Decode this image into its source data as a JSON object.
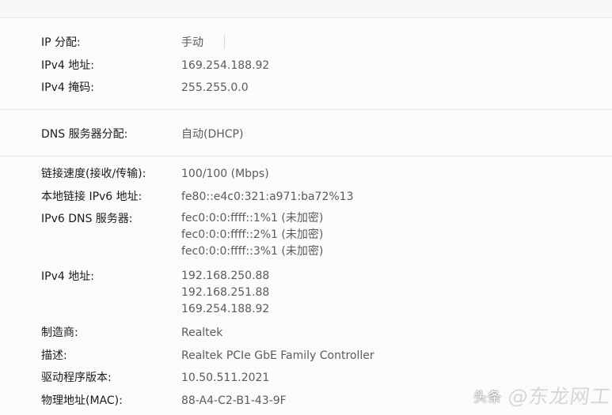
{
  "network_details": {
    "ip_assignment": {
      "label": "IP 分配:",
      "value": "手动"
    },
    "ipv4_address_manual": {
      "label": "IPv4 地址:",
      "value": "169.254.188.92"
    },
    "ipv4_mask": {
      "label": "IPv4 掩码:",
      "value": "255.255.0.0"
    },
    "dns_assignment": {
      "label": "DNS 服务器分配:",
      "value": "自动(DHCP)"
    },
    "link_speed": {
      "label": "链接速度(接收/传输):",
      "value": "100/100 (Mbps)"
    },
    "link_local_ipv6": {
      "label": "本地链接 IPv6 地址:",
      "value": "fe80::e4c0:321:a971:ba72%13"
    },
    "ipv6_dns_servers": {
      "label": "IPv6 DNS 服务器:",
      "values": [
        "fec0:0:0:ffff::1%1 (未加密)",
        "fec0:0:0:ffff::2%1 (未加密)",
        "fec0:0:0:ffff::3%1 (未加密)"
      ]
    },
    "ipv4_addresses": {
      "label": "IPv4 地址:",
      "values": [
        "192.168.250.88",
        "192.168.251.88",
        "169.254.188.92"
      ]
    },
    "manufacturer": {
      "label": "制造商:",
      "value": "Realtek"
    },
    "description": {
      "label": "描述:",
      "value": "Realtek PCIe GbE Family Controller"
    },
    "driver_version": {
      "label": "驱动程序版本:",
      "value": "10.50.511.2021"
    },
    "mac_address": {
      "label": "物理地址(MAC):",
      "value": "88-A4-C2-B1-43-9F"
    }
  },
  "watermark": {
    "left_text": "头条",
    "right_text": "@东龙网工"
  }
}
